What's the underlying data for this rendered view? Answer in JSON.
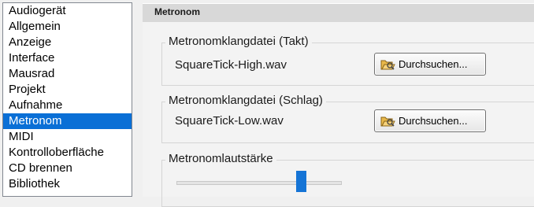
{
  "categories": [
    {
      "label": "Audiogerät"
    },
    {
      "label": "Allgemein"
    },
    {
      "label": "Anzeige"
    },
    {
      "label": "Interface"
    },
    {
      "label": "Mausrad"
    },
    {
      "label": "Projekt"
    },
    {
      "label": "Aufnahme"
    },
    {
      "label": "Metronom"
    },
    {
      "label": "MIDI"
    },
    {
      "label": "Kontrolloberfläche"
    },
    {
      "label": "CD brennen"
    },
    {
      "label": "Bibliothek"
    }
  ],
  "selected_category": "Metronom",
  "panel": {
    "title": "Metronom",
    "takt": {
      "group_title": "Metronomklangdatei (Takt)",
      "file": "SquareTick-High.wav",
      "browse_label": "Durchsuchen..."
    },
    "schlag": {
      "group_title": "Metronomklangdatei (Schlag)",
      "file": "SquareTick-Low.wav",
      "browse_label": "Durchsuchen..."
    },
    "volume": {
      "group_title": "Metronomlautstärke",
      "value_fraction": 0.77
    }
  },
  "colors": {
    "selection": "#0a6fd6",
    "slider_thumb": "#1574d6",
    "header_bg": "#d8d8d8"
  },
  "icons": {
    "browse": "folder-open-icon"
  }
}
